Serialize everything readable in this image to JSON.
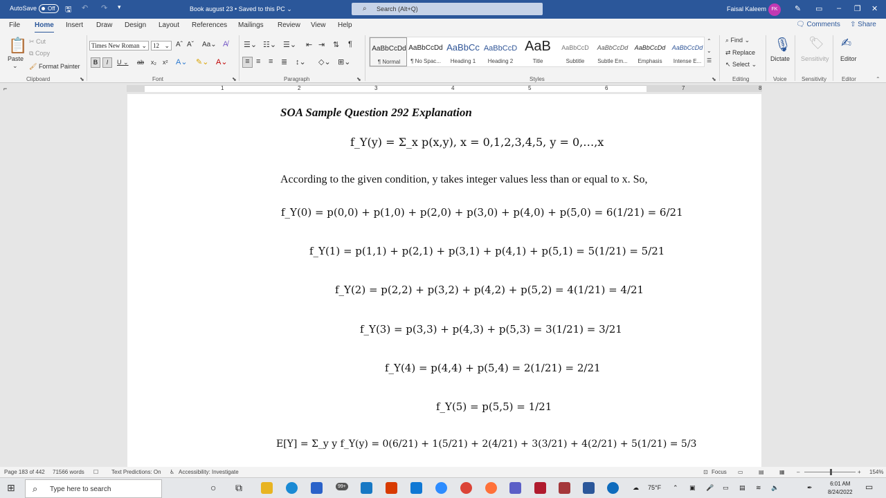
{
  "title_bar": {
    "autosave_label": "AutoSave",
    "autosave_state": "Off",
    "doc_title": "Book august 23 • Saved to this PC ⌄",
    "search_placeholder": "Search (Alt+Q)",
    "user_name": "Faisal Kaleem",
    "user_initials": "FK"
  },
  "menu": {
    "tabs": [
      "File",
      "Home",
      "Insert",
      "Draw",
      "Design",
      "Layout",
      "References",
      "Mailings",
      "Review",
      "View",
      "Help"
    ],
    "active": "Home",
    "comments_label": "Comments",
    "share_label": "Share"
  },
  "ribbon": {
    "clipboard": {
      "paste": "Paste",
      "cut": "Cut",
      "copy": "Copy",
      "format_painter": "Format Painter",
      "group": "Clipboard"
    },
    "font": {
      "name": "Times New Roman",
      "size": "12",
      "group": "Font"
    },
    "paragraph": {
      "group": "Paragraph"
    },
    "styles": {
      "items": [
        {
          "preview": "AaBbCcDd",
          "name": "¶ Normal"
        },
        {
          "preview": "AaBbCcDd",
          "name": "¶ No Spac..."
        },
        {
          "preview": "AaBbCc",
          "name": "Heading 1"
        },
        {
          "preview": "AaBbCcD",
          "name": "Heading 2"
        },
        {
          "preview": "AaB",
          "name": "Title"
        },
        {
          "preview": "AaBbCcD",
          "name": "Subtitle"
        },
        {
          "preview": "AaBbCcDd",
          "name": "Subtle Em..."
        },
        {
          "preview": "AaBbCcDd",
          "name": "Emphasis"
        },
        {
          "preview": "AaBbCcDd",
          "name": "Intense E..."
        }
      ],
      "group": "Styles"
    },
    "editing": {
      "find": "Find",
      "replace": "Replace",
      "select": "Select",
      "group": "Editing"
    },
    "voice": {
      "dictate": "Dictate",
      "group": "Voice"
    },
    "sensitivity": {
      "label": "Sensitivity",
      "group": "Sensitivity"
    },
    "editor": {
      "label": "Editor",
      "group": "Editor"
    }
  },
  "ruler": {
    "numbers": [
      "1",
      "2",
      "3",
      "4",
      "5",
      "6",
      "7",
      "8"
    ]
  },
  "document": {
    "heading": "SOA Sample Question 292 Explanation",
    "intro": "According to the given condition, y takes integer values less than or equal to x.  So,",
    "equations": {
      "marginal": "f_Y(y) = Σ_x p(x,y),     x = 0,1,2,3,4,5,  y = 0,…,x",
      "f0": "f_Y(0) = p(0,0) + p(1,0) + p(2,0) + p(3,0) + p(4,0) + p(5,0) = 6(1/21) = 6/21",
      "f1": "f_Y(1) = p(1,1) + p(2,1) + p(3,1) + p(4,1) + p(5,1) = 5(1/21) = 5/21",
      "f2": "f_Y(2) = p(2,2) + p(3,2) + p(4,2) + p(5,2) = 4(1/21) = 4/21",
      "f3": "f_Y(3) = p(3,3) + p(4,3) + p(5,3) = 3(1/21) = 3/21",
      "f4": "f_Y(4) = p(4,4) + p(5,4) = 2(1/21) = 2/21",
      "f5": "f_Y(5) = p(5,5) = 1/21",
      "ey": "E[Y] = Σ_y y f_Y(y) = 0(6/21) + 1(5/21) + 2(4/21) + 3(3/21) + 4(2/21) + 5(1/21) = 5/3"
    }
  },
  "status_bar": {
    "page": "Page 183 of 442",
    "words": "71566 words",
    "predictions": "Text Predictions: On",
    "accessibility": "Accessibility: Investigate",
    "focus": "Focus",
    "zoom": "154%"
  },
  "taskbar": {
    "search_placeholder": "Type here to search",
    "badge": "99+",
    "weather": "75°F",
    "time": "6:01 AM",
    "date": "8/24/2022"
  }
}
